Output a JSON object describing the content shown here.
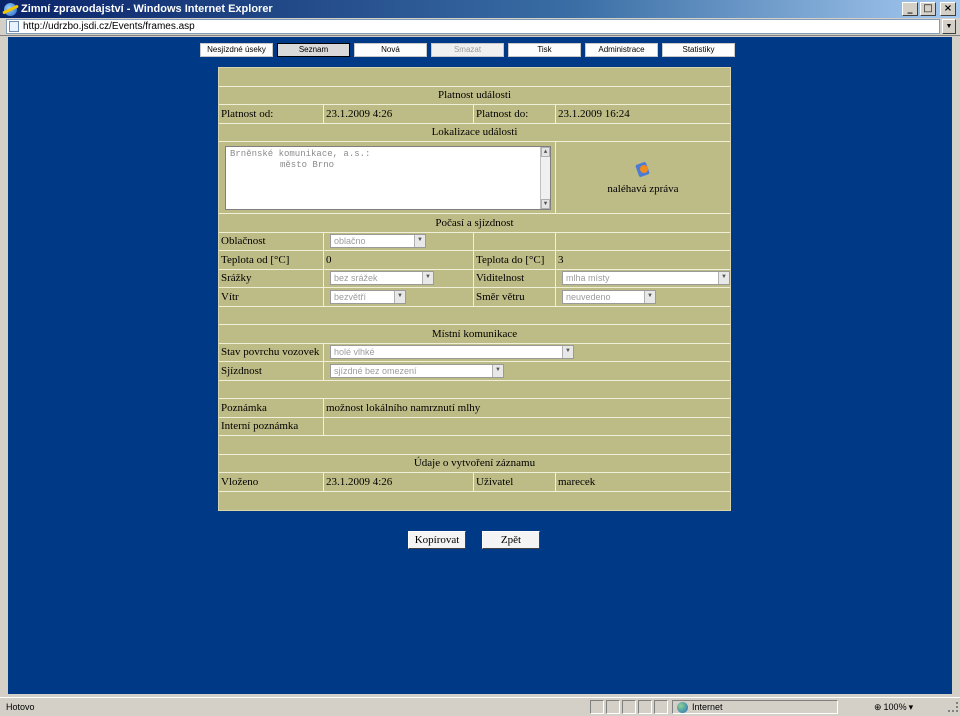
{
  "window": {
    "title": "Zimní zpravodajství - Windows Internet Explorer",
    "url": "http://udrzbo.jsdi.cz/Events/frames.asp",
    "min_label": "_",
    "max_label": "□",
    "close_label": "×",
    "dropdown_glyph": "▼"
  },
  "nav": {
    "items": [
      "Nesjízdné úseky",
      "Seznam",
      "Nová",
      "Smazat",
      "Tisk",
      "Administrace",
      "Statistiky"
    ]
  },
  "validity": {
    "header": "Platnost události",
    "from_label": "Platnost od:",
    "from_value": "23.1.2009 4:26",
    "to_label": "Platnost do:",
    "to_value": "23.1.2009 16:24"
  },
  "location": {
    "header": "Lokalizace události",
    "line1": "Brněnské komunikace, a.s.:",
    "line2": "město Brno",
    "urgent_label": "naléhavá zpráva",
    "scroll_up": "▲",
    "scroll_down": "▼"
  },
  "weather": {
    "header": "Počasí a sjízdnost",
    "cloud_label": "Oblačnost",
    "cloud_value": "oblačno",
    "temp_from_label": "Teplota od [°C]",
    "temp_from_value": "0",
    "temp_to_label": "Teplota do [°C]",
    "temp_to_value": "3",
    "precip_label": "Srážky",
    "precip_value": "bez srážek",
    "visibility_label": "Viditelnost",
    "visibility_value": "mlha místy",
    "wind_label": "Vítr",
    "wind_value": "bezvětří",
    "wind_dir_label": "Směr větru",
    "wind_dir_value": "neuvedeno",
    "dd_glyph": "▼"
  },
  "local": {
    "header": "Místní komunikace",
    "surface_label": "Stav povrchu vozovek",
    "surface_value": "holé vlhké",
    "passability_label": "Sjízdnost",
    "passability_value": "sjízdné bez omezení"
  },
  "notes": {
    "note_label": "Poznámka",
    "note_value": "možnost lokálního namrznutí mlhy",
    "internal_label": "Interní poznámka",
    "internal_value": ""
  },
  "record": {
    "header": "Údaje o vytvoření záznamu",
    "created_label": "Vloženo",
    "created_value": "23.1.2009 4:26",
    "user_label": "Uživatel",
    "user_value": "marecek"
  },
  "actions": {
    "copy_label": "Kopírovat",
    "back_label": "Zpět"
  },
  "status": {
    "text": "Hotovo",
    "zone": "Internet",
    "zoom": "100%",
    "zoom_glyph": "⊕",
    "zoom_dd": "▾"
  }
}
